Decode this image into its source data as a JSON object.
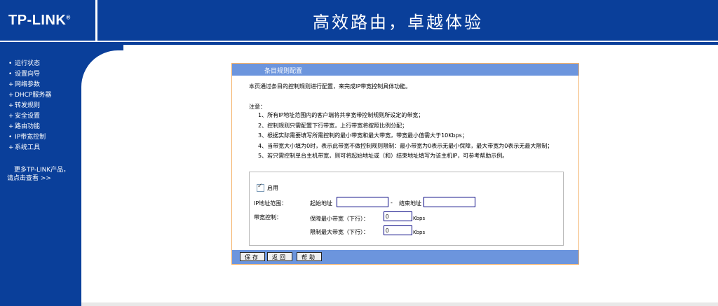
{
  "header": {
    "logo": "TP-LINK",
    "logo_mark": "®",
    "slogan": "高效路由，卓越体验"
  },
  "sidebar": {
    "items": [
      {
        "label": "运行状态"
      },
      {
        "label": "设置向导"
      },
      {
        "label": "网络参数"
      },
      {
        "label": "DHCP服务器"
      },
      {
        "label": "转发规则"
      },
      {
        "label": "安全设置"
      },
      {
        "label": "路由功能"
      },
      {
        "label": "IP带宽控制"
      },
      {
        "label": "系统工具"
      }
    ],
    "more_line1": "更多TP-LINK产品，",
    "more_line2": "请点击查看 >>"
  },
  "panel": {
    "title": "条目规则配置",
    "intro": "本页通过条目的控制规则进行配置，来完成IP带宽控制具体功能。",
    "note_title": "注意：",
    "notes": [
      "1、所有IP地址范围内的客户端将共享宽带控制规则所设定的带宽；",
      "2、控制规则只需配置下行带宽，上行带宽将按照比例分配；",
      "3、根据实际需要填写所需控制的最小带宽和最大带宽，带宽最小值需大于10Kbps；",
      "4、当带宽大小填为0时，表示此带宽不做控制规则限制：最小带宽为0表示无最小保障，最大带宽为0表示无最大限制；",
      "5、若只需控制单台主机带宽，则可将起始地址或（和）结束地址填写为该主机IP，可参考帮助示例。"
    ],
    "form": {
      "enable_label": "启用",
      "ip_range_label": "IP地址范围：",
      "start_label": "起始地址",
      "start_value": "",
      "separator": "-",
      "end_label": "结束地址",
      "end_value": "",
      "bandwidth_label": "带宽控制：",
      "min_label": "保障最小带宽（下行）：",
      "min_value": "0",
      "min_unit": "Kbps",
      "max_label": "限制最大带宽（下行）：",
      "max_value": "0",
      "max_unit": "Kbps"
    },
    "buttons": {
      "save": "保存",
      "back": "返回",
      "help": "帮助"
    }
  },
  "colors": {
    "brand_blue": "#0a3f9a",
    "panel_header": "#6c95dd",
    "panel_border": "#f4b26a"
  }
}
